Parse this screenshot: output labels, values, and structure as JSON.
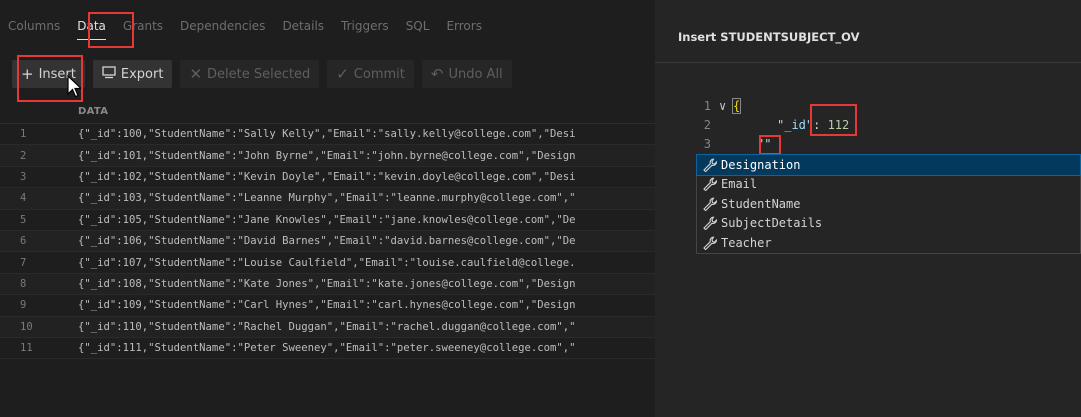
{
  "tabs": [
    "Columns",
    "Data",
    "Grants",
    "Dependencies",
    "Details",
    "Triggers",
    "SQL",
    "Errors"
  ],
  "active_tab": "Data",
  "toolbar": {
    "insert": {
      "icon": "plus-icon",
      "label": "Insert"
    },
    "export": {
      "icon": "export-icon",
      "label": "Export"
    },
    "delete": {
      "icon": "x-icon",
      "label": "Delete Selected"
    },
    "commit": {
      "icon": "check-icon",
      "label": "Commit"
    },
    "undo": {
      "icon": "undo-icon",
      "label": "Undo All"
    }
  },
  "grid": {
    "column": "DATA",
    "rows": [
      {
        "n": "1",
        "v": "{\"_id\":100,\"StudentName\":\"Sally Kelly\",\"Email\":\"sally.kelly@college.com\",\"Desi"
      },
      {
        "n": "2",
        "v": "{\"_id\":101,\"StudentName\":\"John Byrne\",\"Email\":\"john.byrne@college.com\",\"Design"
      },
      {
        "n": "3",
        "v": "{\"_id\":102,\"StudentName\":\"Kevin Doyle\",\"Email\":\"kevin.doyle@college.com\",\"Desi"
      },
      {
        "n": "4",
        "v": "{\"_id\":103,\"StudentName\":\"Leanne Murphy\",\"Email\":\"leanne.murphy@college.com\",\""
      },
      {
        "n": "5",
        "v": "{\"_id\":105,\"StudentName\":\"Jane Knowles\",\"Email\":\"jane.knowles@college.com\",\"De"
      },
      {
        "n": "6",
        "v": "{\"_id\":106,\"StudentName\":\"David Barnes\",\"Email\":\"david.barnes@college.com\",\"De"
      },
      {
        "n": "7",
        "v": "{\"_id\":107,\"StudentName\":\"Louise Caulfield\",\"Email\":\"louise.caulfield@college."
      },
      {
        "n": "8",
        "v": "{\"_id\":108,\"StudentName\":\"Kate Jones\",\"Email\":\"kate.jones@college.com\",\"Design"
      },
      {
        "n": "9",
        "v": "{\"_id\":109,\"StudentName\":\"Carl Hynes\",\"Email\":\"carl.hynes@college.com\",\"Design"
      },
      {
        "n": "10",
        "v": "{\"_id\":110,\"StudentName\":\"Rachel Duggan\",\"Email\":\"rachel.duggan@college.com\",\""
      },
      {
        "n": "11",
        "v": "{\"_id\":111,\"StudentName\":\"Peter Sweeney\",\"Email\":\"peter.sweeney@college.com\",\""
      }
    ]
  },
  "insert_panel": {
    "title": "Insert STUDENTSUBJECT_OV",
    "lines": [
      {
        "n": "1",
        "fold": "∨",
        "text": "{"
      },
      {
        "n": "2",
        "key": "\"_id\"",
        "colon": ": ",
        "value": "112"
      },
      {
        "n": "3",
        "text": "\"\""
      }
    ],
    "suggestions": [
      "Designation",
      "Email",
      "StudentName",
      "SubjectDetails",
      "Teacher"
    ],
    "selected": "Designation",
    "suggestion_icon": "wrench-icon"
  },
  "colors": {
    "highlight": "#e53935",
    "selection": "#04395e",
    "number": "#b5cea8",
    "key": "#9cdcfe",
    "brace": "#ffd700"
  }
}
